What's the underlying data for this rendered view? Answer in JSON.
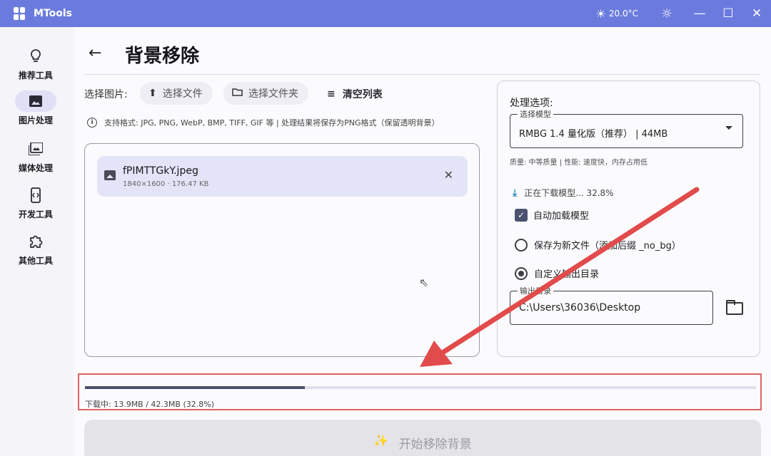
{
  "app": {
    "title": "MTools",
    "weather": "20.0°C"
  },
  "sidebar": {
    "items": [
      {
        "label": "推荐工具",
        "icon": "lightbulb-icon",
        "glyph": "💡"
      },
      {
        "label": "图片处理",
        "icon": "image-icon",
        "glyph": "🖼"
      },
      {
        "label": "媒体处理",
        "icon": "media-icon",
        "glyph": "🎞"
      },
      {
        "label": "开发工具",
        "icon": "code-icon",
        "glyph": "⟨⟩"
      },
      {
        "label": "其他工具",
        "icon": "puzzle-icon",
        "glyph": "✣"
      }
    ]
  },
  "page": {
    "title": "背景移除"
  },
  "toolbar": {
    "select_label": "选择图片:",
    "select_file": "选择文件",
    "select_folder": "选择文件夹",
    "clear_list": "清空列表"
  },
  "info": {
    "text": "支持格式: JPG, PNG, WebP, BMP, TIFF, GIF 等 | 处理结果将保存为PNG格式（保留透明背景）"
  },
  "files": [
    {
      "name": "fPIMTTGkY.jpeg",
      "meta": "1840×1600 · 176.47 KB"
    }
  ],
  "options": {
    "title": "处理选项:",
    "model_label": "选择模型",
    "model_value": "RMBG 1.4 量化版（推荐） | 44MB",
    "model_hint": "质量: 中等质量 | 性能: 速度快，内存占用低",
    "download_status": "正在下载模型... 32.8%",
    "auto_load": "自动加载模型",
    "save_new": "保存为新文件（添加后缀 _no_bg）",
    "custom_output": "自定义输出目录",
    "output_label": "输出目录",
    "output_value": "C:\\Users\\36036\\Desktop"
  },
  "progress": {
    "fraction": 0.328,
    "text": "下载中: 13.9MB / 42.3MB (32.8%)"
  },
  "start": {
    "label": "开始移除背景"
  },
  "colors": {
    "titlebar": "#6b7bdd",
    "annotation_red": "#e24b4b",
    "progress_fill": "#4a5168"
  }
}
